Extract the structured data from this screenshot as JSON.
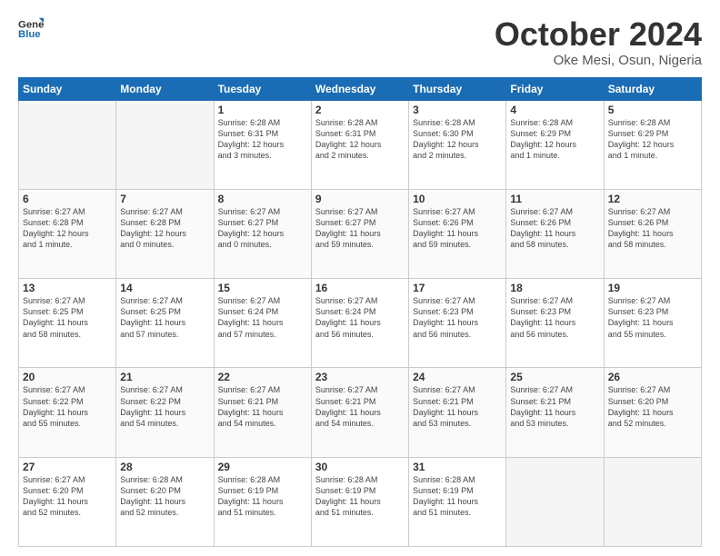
{
  "logo": {
    "text_general": "General",
    "text_blue": "Blue"
  },
  "title": "October 2024",
  "location": "Oke Mesi, Osun, Nigeria",
  "days_of_week": [
    "Sunday",
    "Monday",
    "Tuesday",
    "Wednesday",
    "Thursday",
    "Friday",
    "Saturday"
  ],
  "weeks": [
    [
      {
        "day": "",
        "info": ""
      },
      {
        "day": "",
        "info": ""
      },
      {
        "day": "1",
        "info": "Sunrise: 6:28 AM\nSunset: 6:31 PM\nDaylight: 12 hours\nand 3 minutes."
      },
      {
        "day": "2",
        "info": "Sunrise: 6:28 AM\nSunset: 6:31 PM\nDaylight: 12 hours\nand 2 minutes."
      },
      {
        "day": "3",
        "info": "Sunrise: 6:28 AM\nSunset: 6:30 PM\nDaylight: 12 hours\nand 2 minutes."
      },
      {
        "day": "4",
        "info": "Sunrise: 6:28 AM\nSunset: 6:29 PM\nDaylight: 12 hours\nand 1 minute."
      },
      {
        "day": "5",
        "info": "Sunrise: 6:28 AM\nSunset: 6:29 PM\nDaylight: 12 hours\nand 1 minute."
      }
    ],
    [
      {
        "day": "6",
        "info": "Sunrise: 6:27 AM\nSunset: 6:28 PM\nDaylight: 12 hours\nand 1 minute."
      },
      {
        "day": "7",
        "info": "Sunrise: 6:27 AM\nSunset: 6:28 PM\nDaylight: 12 hours\nand 0 minutes."
      },
      {
        "day": "8",
        "info": "Sunrise: 6:27 AM\nSunset: 6:27 PM\nDaylight: 12 hours\nand 0 minutes."
      },
      {
        "day": "9",
        "info": "Sunrise: 6:27 AM\nSunset: 6:27 PM\nDaylight: 11 hours\nand 59 minutes."
      },
      {
        "day": "10",
        "info": "Sunrise: 6:27 AM\nSunset: 6:26 PM\nDaylight: 11 hours\nand 59 minutes."
      },
      {
        "day": "11",
        "info": "Sunrise: 6:27 AM\nSunset: 6:26 PM\nDaylight: 11 hours\nand 58 minutes."
      },
      {
        "day": "12",
        "info": "Sunrise: 6:27 AM\nSunset: 6:26 PM\nDaylight: 11 hours\nand 58 minutes."
      }
    ],
    [
      {
        "day": "13",
        "info": "Sunrise: 6:27 AM\nSunset: 6:25 PM\nDaylight: 11 hours\nand 58 minutes."
      },
      {
        "day": "14",
        "info": "Sunrise: 6:27 AM\nSunset: 6:25 PM\nDaylight: 11 hours\nand 57 minutes."
      },
      {
        "day": "15",
        "info": "Sunrise: 6:27 AM\nSunset: 6:24 PM\nDaylight: 11 hours\nand 57 minutes."
      },
      {
        "day": "16",
        "info": "Sunrise: 6:27 AM\nSunset: 6:24 PM\nDaylight: 11 hours\nand 56 minutes."
      },
      {
        "day": "17",
        "info": "Sunrise: 6:27 AM\nSunset: 6:23 PM\nDaylight: 11 hours\nand 56 minutes."
      },
      {
        "day": "18",
        "info": "Sunrise: 6:27 AM\nSunset: 6:23 PM\nDaylight: 11 hours\nand 56 minutes."
      },
      {
        "day": "19",
        "info": "Sunrise: 6:27 AM\nSunset: 6:23 PM\nDaylight: 11 hours\nand 55 minutes."
      }
    ],
    [
      {
        "day": "20",
        "info": "Sunrise: 6:27 AM\nSunset: 6:22 PM\nDaylight: 11 hours\nand 55 minutes."
      },
      {
        "day": "21",
        "info": "Sunrise: 6:27 AM\nSunset: 6:22 PM\nDaylight: 11 hours\nand 54 minutes."
      },
      {
        "day": "22",
        "info": "Sunrise: 6:27 AM\nSunset: 6:21 PM\nDaylight: 11 hours\nand 54 minutes."
      },
      {
        "day": "23",
        "info": "Sunrise: 6:27 AM\nSunset: 6:21 PM\nDaylight: 11 hours\nand 54 minutes."
      },
      {
        "day": "24",
        "info": "Sunrise: 6:27 AM\nSunset: 6:21 PM\nDaylight: 11 hours\nand 53 minutes."
      },
      {
        "day": "25",
        "info": "Sunrise: 6:27 AM\nSunset: 6:21 PM\nDaylight: 11 hours\nand 53 minutes."
      },
      {
        "day": "26",
        "info": "Sunrise: 6:27 AM\nSunset: 6:20 PM\nDaylight: 11 hours\nand 52 minutes."
      }
    ],
    [
      {
        "day": "27",
        "info": "Sunrise: 6:27 AM\nSunset: 6:20 PM\nDaylight: 11 hours\nand 52 minutes."
      },
      {
        "day": "28",
        "info": "Sunrise: 6:28 AM\nSunset: 6:20 PM\nDaylight: 11 hours\nand 52 minutes."
      },
      {
        "day": "29",
        "info": "Sunrise: 6:28 AM\nSunset: 6:19 PM\nDaylight: 11 hours\nand 51 minutes."
      },
      {
        "day": "30",
        "info": "Sunrise: 6:28 AM\nSunset: 6:19 PM\nDaylight: 11 hours\nand 51 minutes."
      },
      {
        "day": "31",
        "info": "Sunrise: 6:28 AM\nSunset: 6:19 PM\nDaylight: 11 hours\nand 51 minutes."
      },
      {
        "day": "",
        "info": ""
      },
      {
        "day": "",
        "info": ""
      }
    ]
  ]
}
